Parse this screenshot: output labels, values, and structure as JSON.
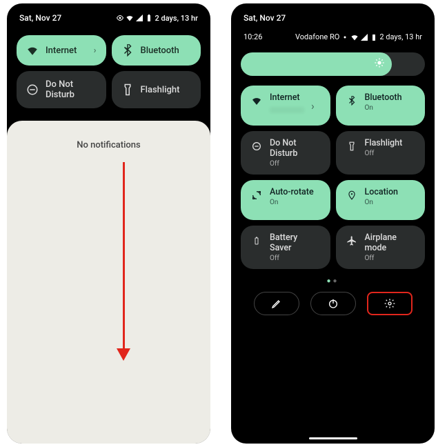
{
  "left": {
    "date": "Sat, Nov 27",
    "battery": "2 days, 13 hr",
    "tiles": [
      {
        "label": "Internet",
        "state": "on",
        "icon": "wifi",
        "chev": true
      },
      {
        "label": "Bluetooth",
        "state": "on",
        "icon": "bluetooth"
      },
      {
        "label": "Do Not Disturb",
        "state": "off",
        "icon": "dnd"
      },
      {
        "label": "Flashlight",
        "state": "off",
        "icon": "flashlight"
      }
    ],
    "notif": "No notifications"
  },
  "right": {
    "date": "Sat, Nov 27",
    "time": "10:26",
    "carrier": "Vodafone RO",
    "battery": "2 days, 13 hr",
    "tiles": [
      {
        "label": "Internet",
        "sub": "",
        "state": "on",
        "icon": "wifi",
        "chev": true,
        "blur": true
      },
      {
        "label": "Bluetooth",
        "sub": "On",
        "state": "on",
        "icon": "bluetooth"
      },
      {
        "label": "Do Not Disturb",
        "sub": "Off",
        "state": "off",
        "icon": "dnd"
      },
      {
        "label": "Flashlight",
        "sub": "Off",
        "state": "off",
        "icon": "flashlight"
      },
      {
        "label": "Auto-rotate",
        "sub": "On",
        "state": "on",
        "icon": "rotate"
      },
      {
        "label": "Location",
        "sub": "On",
        "state": "on",
        "icon": "location"
      },
      {
        "label": "Battery Saver",
        "sub": "Off",
        "state": "off",
        "icon": "battery"
      },
      {
        "label": "Airplane mode",
        "sub": "Off",
        "state": "off",
        "icon": "airplane"
      }
    ]
  }
}
